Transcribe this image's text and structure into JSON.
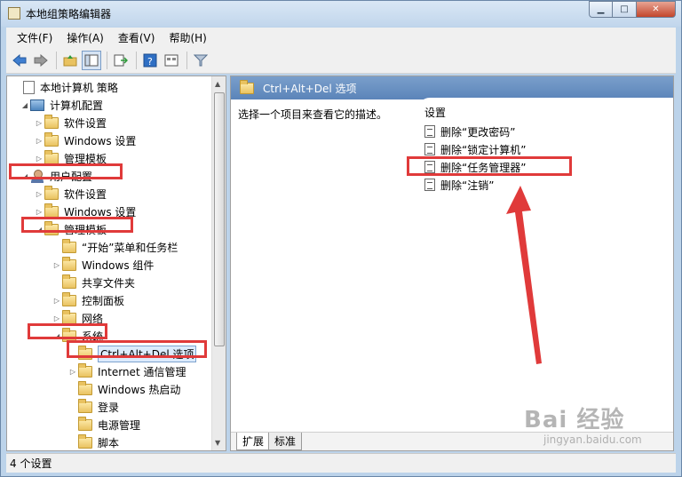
{
  "window": {
    "title": "本地组策略编辑器"
  },
  "menu": [
    "文件(F)",
    "操作(A)",
    "查看(V)",
    "帮助(H)"
  ],
  "tree": [
    {
      "label": "本地计算机 策略",
      "indent": 0,
      "arrow": "",
      "icon": "doc"
    },
    {
      "label": "计算机配置",
      "indent": 1,
      "arrow": "◢",
      "icon": "pc"
    },
    {
      "label": "软件设置",
      "indent": 2,
      "arrow": "▷",
      "icon": "folder"
    },
    {
      "label": "Windows 设置",
      "indent": 2,
      "arrow": "▷",
      "icon": "folder"
    },
    {
      "label": "管理模板",
      "indent": 2,
      "arrow": "▷",
      "icon": "folder"
    },
    {
      "label": "用户配置",
      "indent": 1,
      "arrow": "◢",
      "icon": "user"
    },
    {
      "label": "软件设置",
      "indent": 2,
      "arrow": "▷",
      "icon": "folder"
    },
    {
      "label": "Windows 设置",
      "indent": 2,
      "arrow": "▷",
      "icon": "folder"
    },
    {
      "label": "管理模板",
      "indent": 2,
      "arrow": "◢",
      "icon": "folder"
    },
    {
      "label": "“开始”菜单和任务栏",
      "indent": 3,
      "arrow": "",
      "icon": "folder"
    },
    {
      "label": "Windows 组件",
      "indent": 3,
      "arrow": "▷",
      "icon": "folder"
    },
    {
      "label": "共享文件夹",
      "indent": 3,
      "arrow": "",
      "icon": "folder"
    },
    {
      "label": "控制面板",
      "indent": 3,
      "arrow": "▷",
      "icon": "folder"
    },
    {
      "label": "网络",
      "indent": 3,
      "arrow": "▷",
      "icon": "folder"
    },
    {
      "label": "系统",
      "indent": 3,
      "arrow": "◢",
      "icon": "folder"
    },
    {
      "label": "Ctrl+Alt+Del 选项",
      "indent": 4,
      "arrow": "",
      "icon": "folder",
      "selected": true
    },
    {
      "label": "Internet 通信管理",
      "indent": 4,
      "arrow": "▷",
      "icon": "folder"
    },
    {
      "label": "Windows 热启动",
      "indent": 4,
      "arrow": "",
      "icon": "folder"
    },
    {
      "label": "登录",
      "indent": 4,
      "arrow": "",
      "icon": "folder"
    },
    {
      "label": "电源管理",
      "indent": 4,
      "arrow": "",
      "icon": "folder"
    },
    {
      "label": "脚本",
      "indent": 4,
      "arrow": "",
      "icon": "folder"
    }
  ],
  "right": {
    "header": "Ctrl+Alt+Del 选项",
    "description": "选择一个项目来查看它的描述。",
    "list_header": "设置",
    "items": [
      "删除“更改密码”",
      "删除“锁定计算机”",
      "删除“任务管理器”",
      "删除“注销”"
    ],
    "tabs": [
      "扩展",
      "标准"
    ]
  },
  "status": "4 个设置",
  "watermark": {
    "big": "Bai 经验",
    "small": "jingyan.baidu.com"
  },
  "colors": {
    "annotation": "#e03a3a",
    "header_bg": "#5b84b9"
  }
}
